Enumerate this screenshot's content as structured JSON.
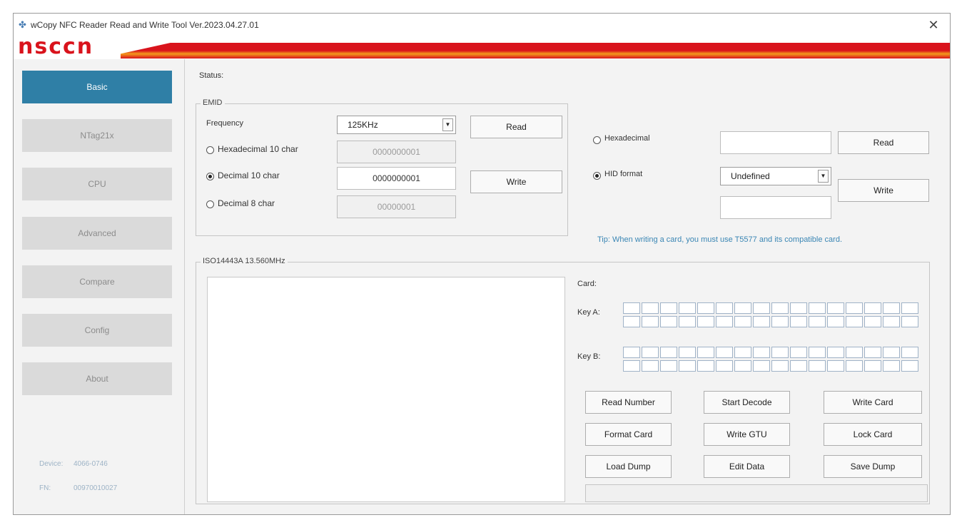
{
  "app": {
    "title": "wCopy NFC Reader Read and Write Tool  Ver.2023.04.27.01",
    "logo": "nsccn",
    "close": "✕"
  },
  "sidebar": {
    "items": [
      {
        "label": "Basic",
        "active": true
      },
      {
        "label": "NTag21x",
        "active": false
      },
      {
        "label": "CPU",
        "active": false
      },
      {
        "label": "Advanced",
        "active": false
      },
      {
        "label": "Compare",
        "active": false
      },
      {
        "label": "Config",
        "active": false
      },
      {
        "label": "About",
        "active": false
      }
    ],
    "info": [
      {
        "label": "Device:",
        "value": "4066-0746"
      },
      {
        "label": "FN:",
        "value": "00970010027"
      }
    ]
  },
  "status": {
    "label": "Status:"
  },
  "emid": {
    "title": "EMID",
    "frequency_label": "Frequency",
    "frequency_value": "125KHz",
    "read_label": "Read",
    "write_label": "Write",
    "options": [
      {
        "label": "Hexadecimal 10 char",
        "value": "0000000001",
        "selected": false,
        "editable": false
      },
      {
        "label": "Decimal 10 char",
        "value": "0000000001",
        "selected": true,
        "editable": true
      },
      {
        "label": "Decimal 8 char",
        "value": "00000001",
        "selected": false,
        "editable": false
      }
    ]
  },
  "hid": {
    "hex_label": "Hexadecimal",
    "hid_label": "HID format",
    "hid_selected": true,
    "format_value": "Undefined",
    "read_label": "Read",
    "write_label": "Write",
    "tip": "Tip: When writing a card, you must use T5577 and its compatible card."
  },
  "iso": {
    "title": "ISO14443A 13.560MHz",
    "card_label": "Card:",
    "key_a_label": "Key A:",
    "key_b_label": "Key B:",
    "buttons": {
      "read_number": "Read Number",
      "start_decode": "Start Decode",
      "write_card": "Write Card",
      "format_card": "Format Card",
      "write_gtu": "Write GTU",
      "lock_card": "Lock Card",
      "load_dump": "Load Dump",
      "edit_data": "Edit Data",
      "save_dump": "Save Dump"
    }
  },
  "colors": {
    "accent": "#2f7fa6",
    "brand_red": "#d9131c",
    "brand_orange": "#f39a1c",
    "tip": "#3a86b4"
  }
}
